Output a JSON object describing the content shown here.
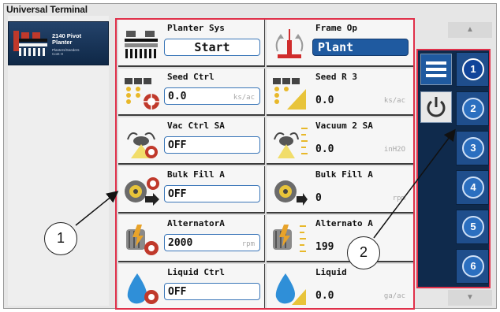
{
  "window": {
    "title": "Universal Terminal"
  },
  "implement": {
    "name_line1": "2140 Pivot",
    "name_line2": "Planter",
    "sub_line1": "Planters/Seeders",
    "sub_line2": "Cont H"
  },
  "cells": [
    {
      "label": "Planter Sys",
      "value": "Start",
      "unit": "",
      "style": "button"
    },
    {
      "label": "Frame Op",
      "value": "Plant",
      "unit": "",
      "style": "button-selected"
    },
    {
      "label": "Seed Ctrl",
      "value": "0.0",
      "unit": "ks/ac",
      "style": "box"
    },
    {
      "label": "Seed R 3",
      "value": "0.0",
      "unit": "ks/ac",
      "style": "plain"
    },
    {
      "label": "Vac Ctrl SA",
      "value": "OFF",
      "unit": "",
      "style": "box"
    },
    {
      "label": "Vacuum 2  SA",
      "value": "0.0",
      "unit": "inH2O",
      "style": "plain"
    },
    {
      "label": "Bulk Fill A",
      "value": "OFF",
      "unit": "",
      "style": "box"
    },
    {
      "label": "Bulk Fill A",
      "value": "0",
      "unit": "rpm",
      "style": "plain"
    },
    {
      "label": "AlternatorA",
      "value": "2000",
      "unit": "rpm",
      "style": "box"
    },
    {
      "label": "Alternato A",
      "value": "199",
      "unit": "",
      "style": "plain"
    },
    {
      "label": "Liquid Ctrl",
      "value": "OFF",
      "unit": "",
      "style": "box"
    },
    {
      "label": "Liquid",
      "value": "0.0",
      "unit": "ga/ac",
      "style": "plain"
    }
  ],
  "right_panel": {
    "menu_icon": "hamburger-menu-icon",
    "power_icon": "power-icon",
    "pages": [
      "1",
      "2",
      "3",
      "4",
      "5",
      "6"
    ],
    "active_page": "1"
  },
  "callouts": {
    "callout_1": "1",
    "callout_2": "2"
  },
  "colors": {
    "highlight_border": "#e0304a",
    "accent_blue": "#1f5aa0",
    "dark_navy": "#0f2a4c"
  }
}
